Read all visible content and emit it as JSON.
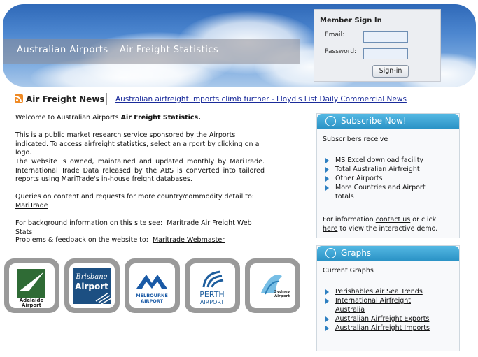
{
  "header": {
    "title": "Australian Airports – Air Freight Statistics"
  },
  "signin": {
    "heading": "Member Sign In",
    "email_label": "Email:",
    "password_label": "Password:",
    "button": "Sign-in"
  },
  "news": {
    "title": "Air Freight News",
    "link": "Australian airfreight imports climb further - Lloyd's List Daily Commercial News"
  },
  "main": {
    "welcome_prefix": "Welcome to Australian Airports ",
    "welcome_bold": "Air Freight Statistics.",
    "p1": "This is a public market research service sponsored by the Airports indicated. To access airfreight statistics, select an airport by clicking on a logo.",
    "p2": "The website is owned, maintained and updated monthly by MariTrade. International Trade Data released by the ABS is converted into tailored reports using MariTrade's in-house freight databases.",
    "p3_text": "Queries on content and requests for more country/commodity detail to:",
    "p3_link": "MariTrade",
    "p4_text": "For background information on this site see:",
    "p4_link": "Maritrade Air Freight Web Stats",
    "p5_text": "Problems & feedback on the website to:",
    "p5_link": "Maritrade Webmaster"
  },
  "logos": [
    {
      "name": "Adelaide",
      "line1": "Adelaide",
      "line2": "Airport"
    },
    {
      "name": "Brisbane",
      "line1": "Brisbane",
      "line2": "Airport"
    },
    {
      "name": "Melbourne",
      "line1": "MELBOURNE",
      "line2": "AIRPORT"
    },
    {
      "name": "Perth",
      "line1": "PERTH",
      "line2": "AIRPORT"
    },
    {
      "name": "Sydney",
      "line1": "Sydney",
      "line2": "Airport"
    }
  ],
  "subscribe": {
    "title": "Subscribe Now!",
    "intro": "Subscribers receive",
    "items": [
      "MS Excel download facility",
      "Total Australian Airfreight",
      "Other Airports",
      "More Countries and Airport totals"
    ],
    "info_prefix": "For information ",
    "contact_link": "contact us",
    "info_mid": " or click",
    "here_link": "here",
    "info_suffix": " to view the interactive demo."
  },
  "graphs": {
    "title": "Graphs",
    "intro": "Current Graphs",
    "items": [
      "Perishables Air Sea Trends",
      "International Airfreight Australia",
      "Australian Airfreight Exports",
      "Australian Airfreight Imports"
    ]
  },
  "colors": {
    "panel_header": "#2b93c6",
    "link_blue": "#1a2b9a",
    "rss_orange": "#f08a24"
  }
}
